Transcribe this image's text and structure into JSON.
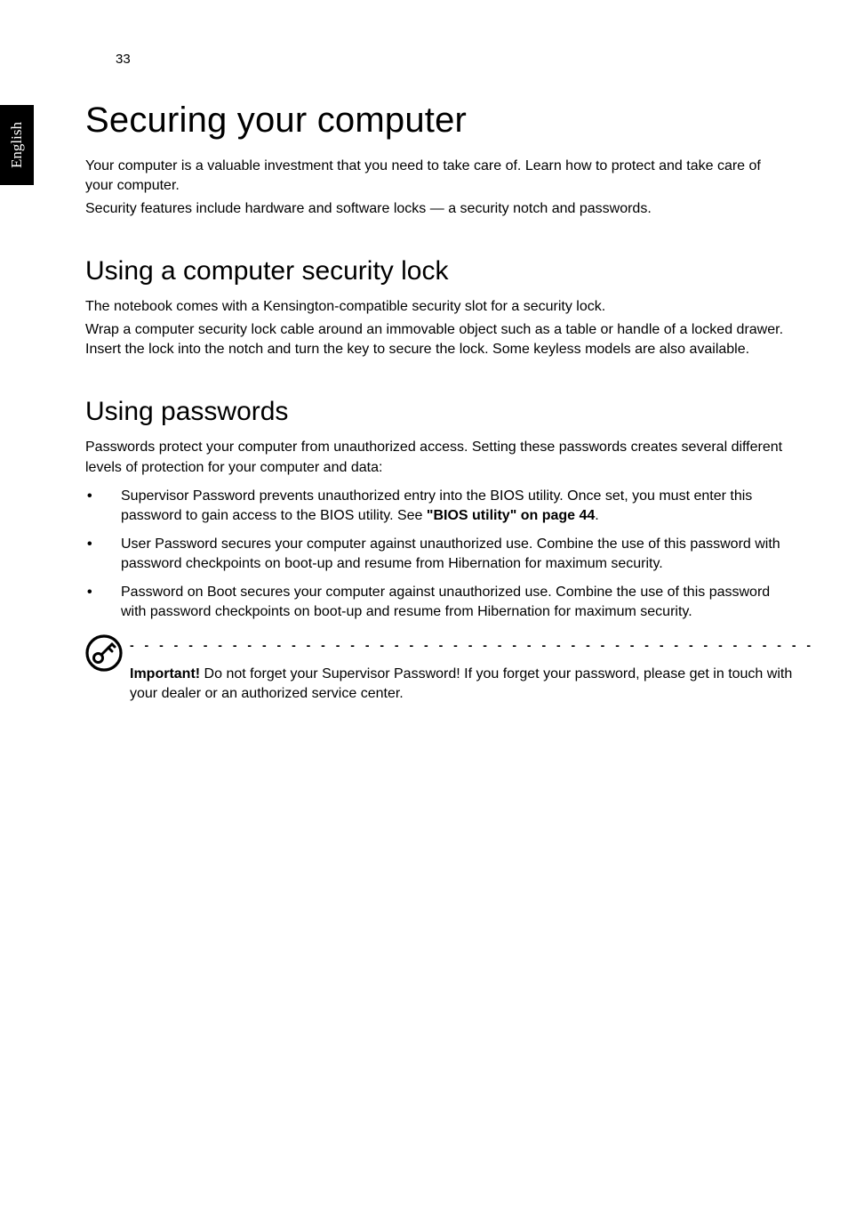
{
  "sideTab": "English",
  "pageNumber": "33",
  "h1": "Securing your computer",
  "intro1": "Your computer is a valuable investment that you need to take care of. Learn how to protect and take care of your computer.",
  "intro2": "Security features include hardware and software locks — a security notch and passwords.",
  "sec1": {
    "heading": "Using a computer security lock",
    "p1": "The notebook comes with a Kensington-compatible security slot for a security lock.",
    "p2": "Wrap a computer security lock cable around an immovable object such as a table or handle of a locked drawer. Insert the lock into the notch and turn the key to secure the lock. Some keyless models are also available."
  },
  "sec2": {
    "heading": "Using passwords",
    "intro": "Passwords protect your computer from unauthorized access. Setting these passwords creates several different levels of protection for your computer and data:",
    "bullets": [
      {
        "pre": "Supervisor Password prevents unauthorized entry into the BIOS utility. Once set, you must enter this password to gain access to the BIOS utility. See ",
        "link": "\"BIOS utility\" on page 44",
        "post": "."
      },
      {
        "pre": "User Password secures your computer against unauthorized use. Combine the use of this password with password checkpoints on boot-up and resume from Hibernation for maximum security.",
        "link": "",
        "post": ""
      },
      {
        "pre": "Password on Boot secures your computer against unauthorized use. Combine the use of this password with password checkpoints on boot-up and resume from Hibernation for maximum security.",
        "link": "",
        "post": ""
      }
    ],
    "note": {
      "strong": "Important!",
      "text": " Do not forget your Supervisor Password! If you forget your password, please get in touch with your dealer or an authorized service center."
    }
  },
  "dashes": "- - - - - - - - - - - - - - - - - - - - - - - - - - - - - - - - - - - - - - - - - - - - - - -"
}
